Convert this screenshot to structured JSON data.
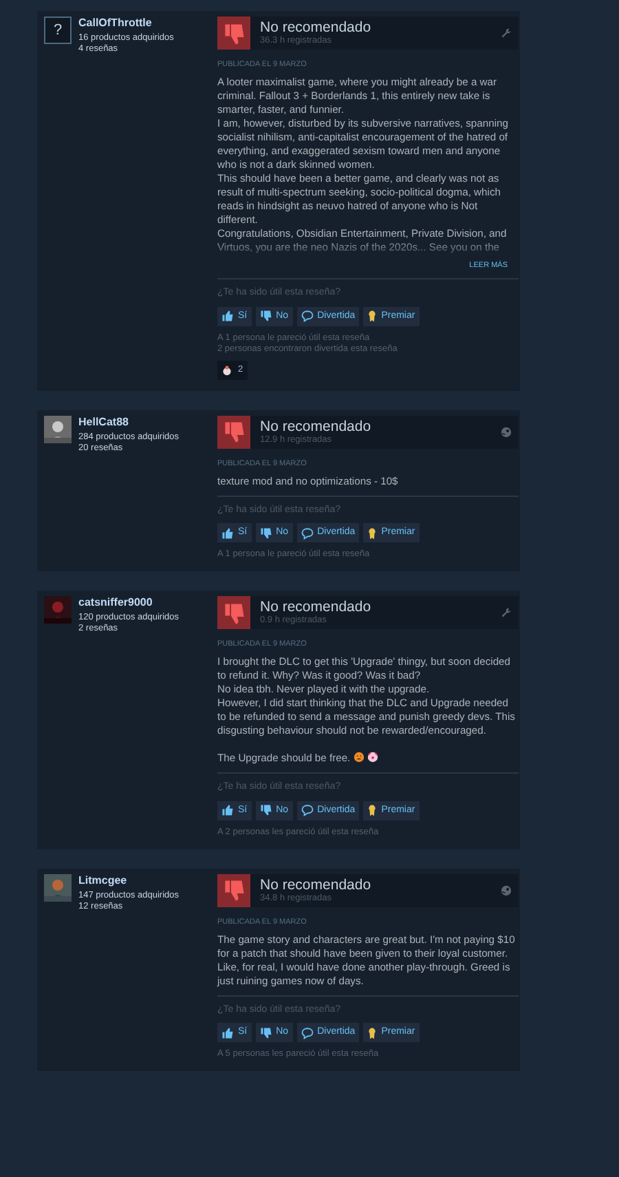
{
  "reviews": [
    {
      "author": {
        "name": "CallOfThrottle",
        "products": "16 productos adquiridos",
        "reviews": "4 reseñas",
        "avatar": {
          "kind": "placeholder",
          "glyph": "?"
        }
      },
      "verdict": "No recomendado",
      "hours": "36.3 h registradas",
      "platform": {
        "kind": "tool"
      },
      "date": "PUBLICADA EL 9 MARZO",
      "body": [
        "A looter maximalist game, where you might already be a war criminal. Fallout 3 + Borderlands 1, this entirely new take is smarter, faster, and funnier.",
        "I am, however, disturbed by its subversive narratives, spanning socialist nihilism, anti-capitalist encouragement of the hatred of everything, and exaggerated sexism toward men and anyone who is not a dark skinned women.",
        "This should have been a better game, and clearly was not as result of multi-spectrum seeking, socio-political dogma, which reads in hindsight as neuvo hatred of anyone who is Not different.",
        "Congratulations, Obsidian Entertainment, Private Division, and Virtuos, you are the neo Nazis of the 2020s... See you on the"
      ],
      "faded": true,
      "read_more": "LEER MÁS",
      "question": "¿Te ha sido útil esta reseña?",
      "buttons": [
        {
          "kind": "yes",
          "label": "Sí"
        },
        {
          "kind": "no",
          "label": "No"
        },
        {
          "kind": "funny",
          "label": "Divertida"
        },
        {
          "kind": "award",
          "label": "Premiar"
        }
      ],
      "stats": [
        "A 1 persona le pareció útil esta reseña",
        "2 personas encontraron divertida esta reseña"
      ],
      "awards": [
        {
          "count": "2"
        }
      ]
    },
    {
      "author": {
        "name": "HellCat88",
        "products": "284 productos adquiridos",
        "reviews": "20 reseñas"
      },
      "verdict": "No recomendado",
      "hours": "12.9 h registradas",
      "platform": {
        "kind": "steam"
      },
      "date": "PUBLICADA EL 9 MARZO",
      "body": [
        "texture mod and no optimizations - 10$"
      ],
      "faded": false,
      "question": "¿Te ha sido útil esta reseña?",
      "buttons": [
        {
          "kind": "yes",
          "label": "Sí"
        },
        {
          "kind": "no",
          "label": "No"
        },
        {
          "kind": "funny",
          "label": "Divertida"
        },
        {
          "kind": "award",
          "label": "Premiar"
        }
      ],
      "stats": [
        "A 1 persona le pareció útil esta reseña"
      ]
    },
    {
      "author": {
        "name": "catsniffer9000",
        "products": "120 productos adquiridos",
        "reviews": "2 reseñas"
      },
      "verdict": "No recomendado",
      "hours": "0.9 h registradas",
      "platform": {
        "kind": "tool"
      },
      "date": "PUBLICADA EL 9 MARZO",
      "body": [
        "I brought the DLC to get this 'Upgrade' thingy, but soon decided to refund it. Why? Was it good? Was it bad?",
        "No idea tbh. Never played it with the upgrade.",
        "However, I did start thinking that the DLC and Upgrade needed to be refunded to send a message and punish greedy devs. This disgusting behaviour should not be rewarded/encouraged."
      ],
      "closing": {
        "text": "The Upgrade should be free.",
        "emoticons": [
          {
            "kind": "angry"
          },
          {
            "kind": "clown"
          }
        ]
      },
      "faded": false,
      "question": "¿Te ha sido útil esta reseña?",
      "buttons": [
        {
          "kind": "yes",
          "label": "Sí"
        },
        {
          "kind": "no",
          "label": "No"
        },
        {
          "kind": "funny",
          "label": "Divertida"
        },
        {
          "kind": "award",
          "label": "Premiar"
        }
      ],
      "stats": [
        "A 2 personas les pareció útil esta reseña"
      ]
    },
    {
      "author": {
        "name": "Litmcgee",
        "products": "147 productos adquiridos",
        "reviews": "12 reseñas"
      },
      "verdict": "No recomendado",
      "hours": "34.8 h registradas",
      "platform": {
        "kind": "steam"
      },
      "date": "PUBLICADA EL 9 MARZO",
      "body": [
        "The game story and characters are great but. I'm not paying $10 for a patch that should have been given to their loyal customer. Like, for real, I would have done another play-through. Greed is just ruining games now of days."
      ],
      "faded": false,
      "question": "¿Te ha sido útil esta reseña?",
      "buttons": [
        {
          "kind": "yes",
          "label": "Sí"
        },
        {
          "kind": "no",
          "label": "No"
        },
        {
          "kind": "funny",
          "label": "Divertida"
        },
        {
          "kind": "award",
          "label": "Premiar"
        }
      ],
      "stats": [
        "A 5 personas les pareció útil esta reseña"
      ]
    }
  ]
}
